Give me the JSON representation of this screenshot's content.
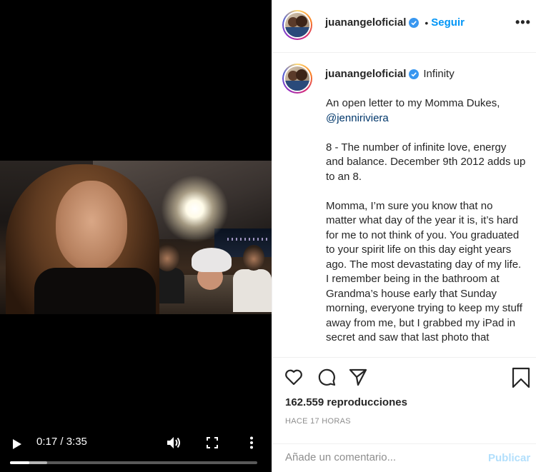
{
  "video": {
    "current_time": "0:17",
    "duration": "3:35",
    "time_label": "0:17 / 3:35",
    "progress_fraction": 0.079,
    "buffered_fraction": 0.15,
    "icons": {
      "play": "play-icon",
      "volume": "volume-icon",
      "fullscreen": "fullscreen-icon",
      "more": "more-vertical-icon"
    }
  },
  "header": {
    "username": "juanangeloficial",
    "verified": true,
    "separator": "•",
    "follow_label": "Seguir",
    "more": "•••"
  },
  "caption": {
    "username": "juanangeloficial",
    "location": "Infinity",
    "line1": "An open letter to my Momma Dukes,",
    "mention": "@jenniriviera",
    "paragraph2": "8 - The number of infinite love, energy and balance. December 9th 2012 adds up to an 8.",
    "paragraph3": "Momma, I’m sure you know that no matter what day of the year it is, it’s hard for me to not think of you. You graduated to your spirit life on this day eight years ago. The most devastating day of my life. I remember being in the bathroom at Grandma’s house early that Sunday morning, everyone trying to keep my stuff away from me, but I grabbed my iPad in secret and saw that last photo that"
  },
  "actions": {
    "icons": [
      "heart-icon",
      "comment-icon",
      "share-icon",
      "bookmark-icon"
    ],
    "views": "162.559 reproducciones",
    "time_ago": "HACE 17 HORAS"
  },
  "comment": {
    "placeholder": "Añade un comentario...",
    "post_label": "Publicar"
  },
  "colors": {
    "accent": "#0095f6",
    "post_disabled": "#b2dffc",
    "mention": "#00376b",
    "muted": "#8e8e8e"
  }
}
